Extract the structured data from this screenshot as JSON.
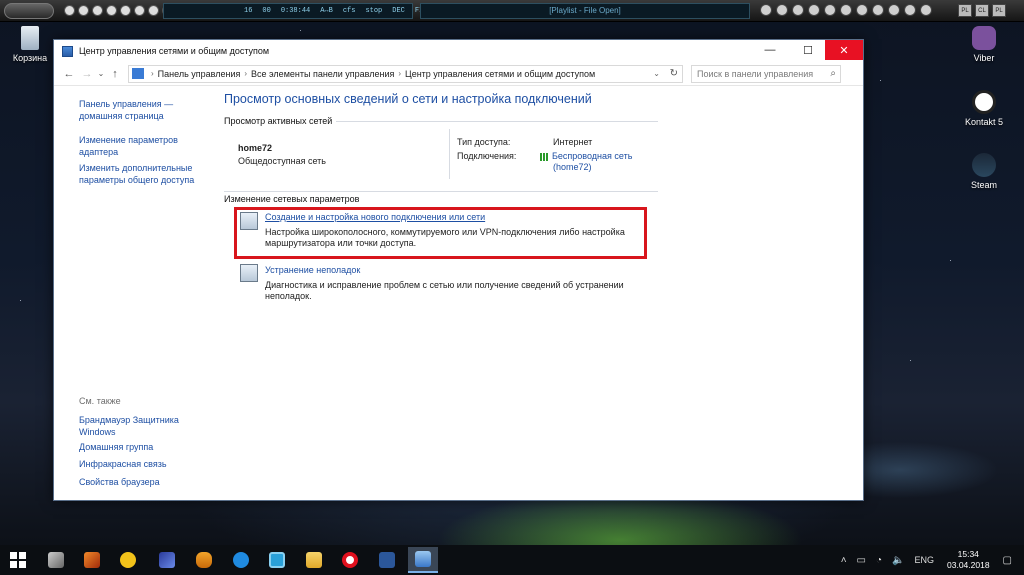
{
  "player": {
    "lcd_text": [
      "16",
      "00",
      "0:38:44",
      "A↔B",
      "cfs",
      "stop",
      "DEC",
      "FILE"
    ],
    "playlist_title": "[Playlist - File Open]",
    "right_buttons": [
      "PL",
      "CL",
      "PL"
    ]
  },
  "desktop": {
    "icons": [
      {
        "label": "Корзина",
        "icon": "recycle-bin-icon"
      },
      {
        "label": "Viber",
        "icon": "viber-icon"
      },
      {
        "label": "Kontakt 5",
        "icon": "kontakt-icon"
      },
      {
        "label": "Steam",
        "icon": "steam-icon"
      }
    ]
  },
  "window": {
    "title": "Центр управления сетями и общим доступом",
    "controls": {
      "minimize": "—",
      "maximize": "☐",
      "close": "✕"
    },
    "nav": {
      "back": "←",
      "forward": "→",
      "recent": "⌄",
      "up": "↑"
    },
    "breadcrumb": [
      "Панель управления",
      "Все элементы панели управления",
      "Центр управления сетями и общим доступом"
    ],
    "search_placeholder": "Поиск в панели управления",
    "sidebar": {
      "links": [
        {
          "line1": "Панель управления —",
          "line2": "домашняя страница"
        },
        {
          "line1": "Изменение параметров",
          "line2": "адаптера"
        },
        {
          "line1": "Изменить дополнительные",
          "line2": "параметры общего доступа"
        }
      ],
      "see_also_heading": "См. также",
      "see_also": [
        {
          "line1": "Брандмауэр Защитника",
          "line2": "Windows"
        },
        {
          "line1": "Домашняя группа",
          "line2": ""
        },
        {
          "line1": "Инфракрасная связь",
          "line2": ""
        },
        {
          "line1": "Свойства браузера",
          "line2": ""
        }
      ]
    },
    "main": {
      "heading": "Просмотр основных сведений о сети и настройка подключений",
      "active_networks_heading": "Просмотр активных сетей",
      "network_name": "home72",
      "network_type": "Общедоступная сеть",
      "access_type_label": "Тип доступа:",
      "access_type_value": "Интернет",
      "connections_label": "Подключения:",
      "connection_value_line1": "Беспроводная сеть",
      "connection_value_line2": "(home72)",
      "change_settings_heading": "Изменение сетевых параметров",
      "items": [
        {
          "link": "Создание и настройка нового подключения или сети",
          "desc_line1": "Настройка широкополосного, коммутируемого или VPN-подключения либо настройка",
          "desc_line2": "маршрутизатора или точки доступа."
        },
        {
          "link": "Устранение неполадок",
          "desc_line1": "Диагностика и исправление проблем с сетью или получение сведений об устранении",
          "desc_line2": "неполадок."
        }
      ]
    }
  },
  "taskbar": {
    "apps": [
      "windows-start-icon",
      "scanner-app-icon",
      "fl-studio-icon",
      "app-yellow-icon",
      "app-wave-icon",
      "fruit-icon",
      "ccleaner-icon",
      "app-blue-icon",
      "file-explorer-icon",
      "opera-icon",
      "word-icon",
      "network-window-icon"
    ],
    "language": "ENG",
    "time": "15:34",
    "date": "03.04.2018"
  },
  "colors": {
    "link": "#1e4fa3",
    "highlight": "#d8161c",
    "close_button": "#e81123"
  }
}
